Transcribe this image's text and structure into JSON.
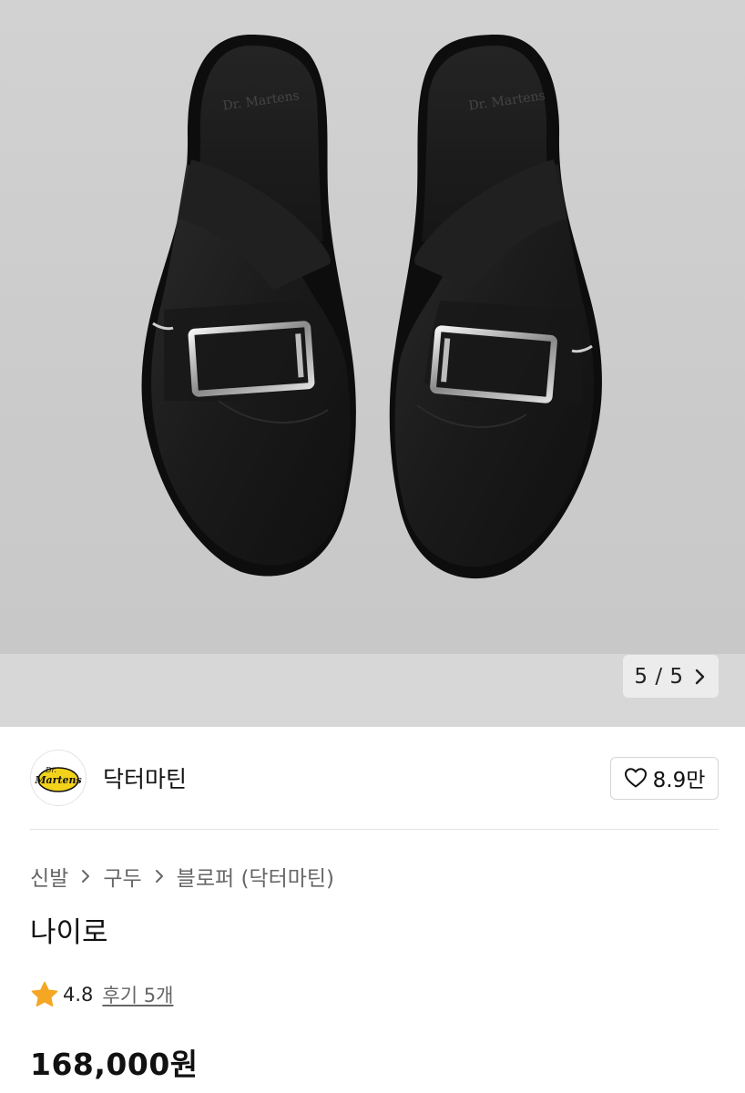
{
  "gallery": {
    "image_counter": "5 / 5",
    "next_icon": "chevron-right-icon",
    "background_color": "#cdcdcd"
  },
  "brand": {
    "logo_text": "Dr. Martens",
    "name": "닥터마틴",
    "like_icon": "heart-outline-icon",
    "like_count": "8.9만"
  },
  "breadcrumb": {
    "items": [
      "신발",
      "구두",
      "블로퍼 (닥터마틴)"
    ],
    "separator_icon": "chevron-right-icon"
  },
  "product": {
    "title": "나이로",
    "rating": "4.8",
    "rating_icon": "star-icon",
    "rating_color": "#f5a623",
    "reviews_label": "후기 5개",
    "price": "168,000원"
  }
}
